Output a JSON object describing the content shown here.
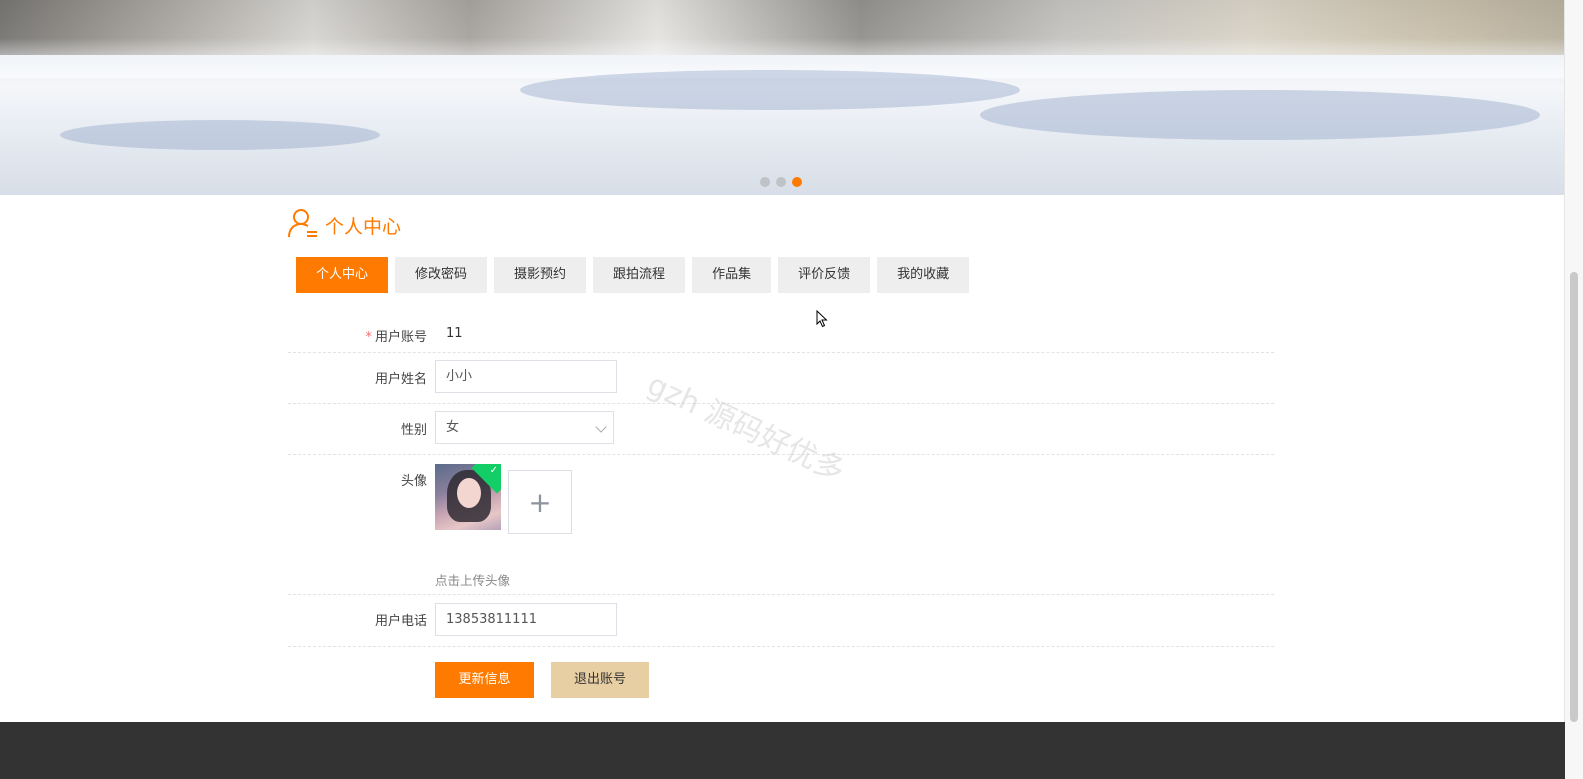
{
  "banner": {
    "slide_count": 3,
    "active_slide": 3
  },
  "section": {
    "title": "个人中心",
    "icon": "user-icon"
  },
  "tabs": [
    {
      "label": "个人中心",
      "active": true
    },
    {
      "label": "修改密码",
      "active": false
    },
    {
      "label": "摄影预约",
      "active": false
    },
    {
      "label": "跟拍流程",
      "active": false
    },
    {
      "label": "作品集",
      "active": false
    },
    {
      "label": "评价反馈",
      "active": false
    },
    {
      "label": "我的收藏",
      "active": false
    }
  ],
  "form": {
    "account": {
      "required_mark": "*",
      "label": "用户账号",
      "value": "11"
    },
    "name": {
      "label": "用户姓名",
      "value": "小小"
    },
    "gender": {
      "label": "性别",
      "value": "女"
    },
    "avatar": {
      "label": "头像",
      "hint": "点击上传头像",
      "upload_icon": "plus-icon"
    },
    "phone": {
      "label": "用户电话",
      "value": "13853811111"
    }
  },
  "buttons": {
    "update": "更新信息",
    "logout": "退出账号"
  },
  "watermark": "gzh 源码好优多",
  "colors": {
    "accent": "#ff7a00",
    "logout_button": "#e8cfa3",
    "footer": "#333333"
  }
}
